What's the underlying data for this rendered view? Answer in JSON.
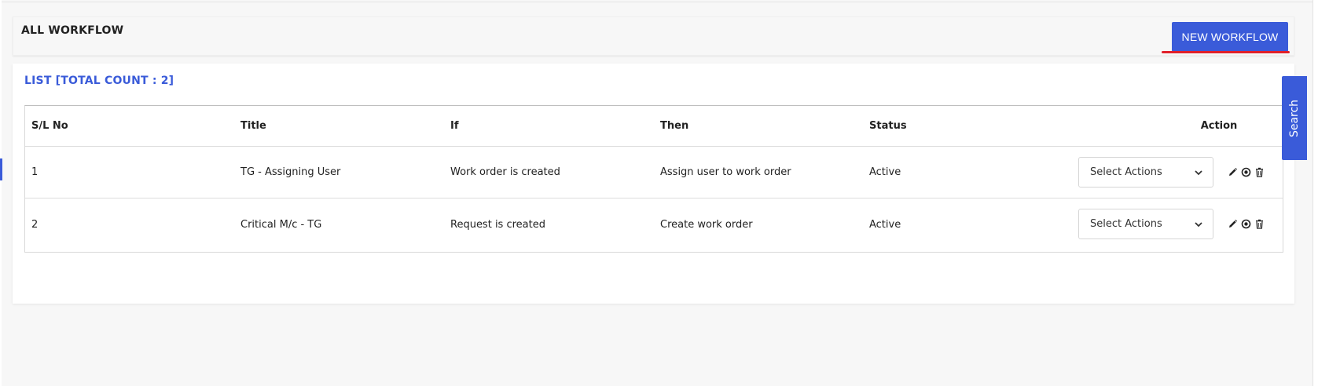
{
  "header": {
    "title": "ALL WORKFLOW",
    "new_button_label": "NEW WORKFLOW"
  },
  "list": {
    "title": "LIST [TOTAL COUNT : 2]",
    "columns": {
      "sl": "S/L No",
      "title": "Title",
      "if": "If",
      "then": "Then",
      "status": "Status",
      "action": "Action"
    },
    "rows": [
      {
        "sl": "1",
        "title": "TG - Assigning User",
        "if": "Work order is created",
        "then": "Assign user to work order",
        "status": "Active",
        "action_select": "Select Actions"
      },
      {
        "sl": "2",
        "title": "Critical M/c - TG",
        "if": "Request is created",
        "then": "Create work order",
        "status": "Active",
        "action_select": "Select Actions"
      }
    ],
    "row_icons": [
      "edit-icon",
      "view-icon",
      "delete-icon"
    ]
  },
  "search_tab": {
    "label": "Search"
  },
  "colors": {
    "accent": "#3a5bd9",
    "highlight": "#e0202a",
    "background": "#f7f7f7"
  }
}
